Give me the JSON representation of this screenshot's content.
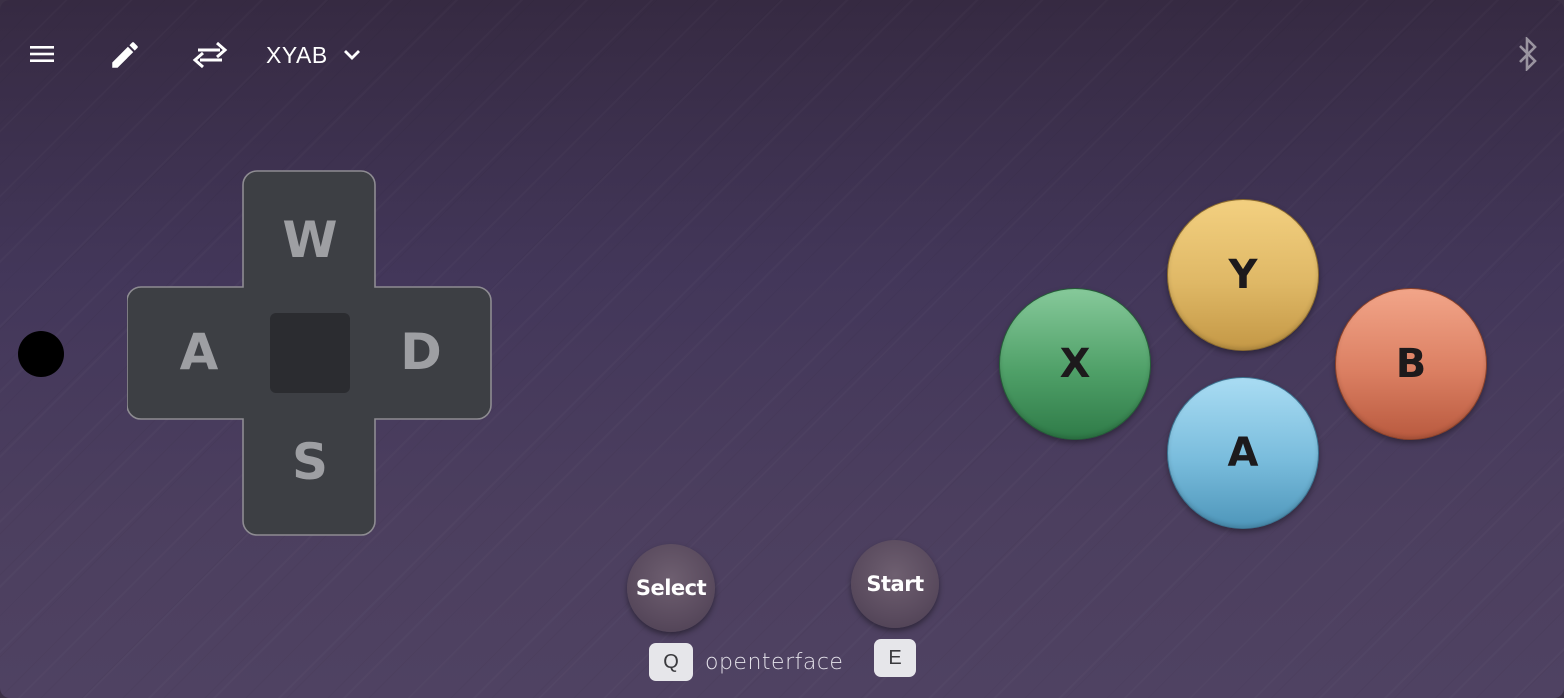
{
  "header": {
    "menu_icon": "menu-icon",
    "edit_icon": "pencil-icon",
    "swap_icon": "swap-arrows-icon",
    "layout_label": "XYAB",
    "layout_dropdown_icon": "chevron-down-icon",
    "bluetooth_icon": "bluetooth-icon"
  },
  "dpad": {
    "up": "W",
    "left": "A",
    "right": "D",
    "down": "S"
  },
  "face_buttons": {
    "y": "Y",
    "x": "X",
    "b": "B",
    "a": "A",
    "colors": {
      "y": "#dfb866",
      "x": "#4fa068",
      "b": "#db7f62",
      "a": "#79bcdc"
    }
  },
  "meta_buttons": {
    "select": "Select",
    "start": "Start",
    "select_key": "Q",
    "start_key": "E"
  },
  "brand": "openterface"
}
